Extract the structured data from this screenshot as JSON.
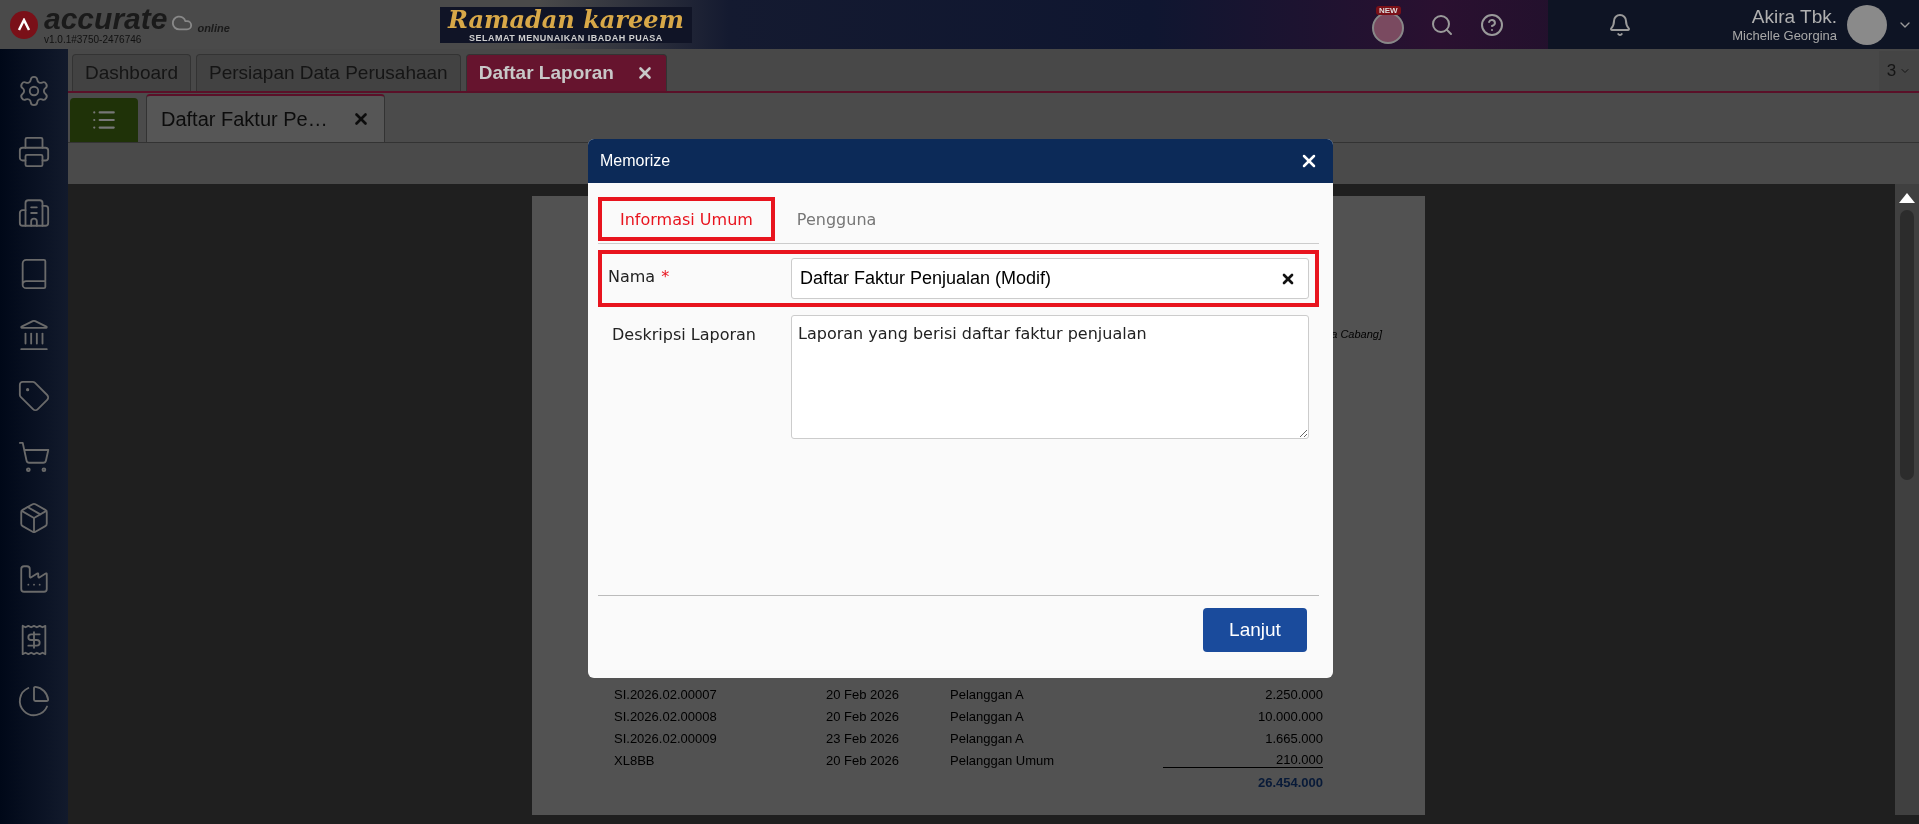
{
  "app": {
    "logo": "accurate",
    "logo_sub": "online",
    "version": "v1.0.1#3750-2476746"
  },
  "banner": {
    "title": "Ramadan kareem",
    "subtitle": "SELAMAT MENUNAIKAN IBADAH PUASA"
  },
  "header": {
    "badge": "NEW",
    "user_name": "Akira Tbk.",
    "user_sub": "Michelle Georgina"
  },
  "tabs": [
    {
      "label": "Dashboard",
      "selected": false,
      "closable": false
    },
    {
      "label": "Persiapan Data Perusahaan",
      "selected": false,
      "closable": false
    },
    {
      "label": "Daftar Laporan",
      "selected": true,
      "closable": true
    }
  ],
  "tab_count": "3",
  "subtab": {
    "label": "Daftar Faktur Pe…"
  },
  "report": {
    "note": "a Cabang]",
    "rows": [
      {
        "number": "SI.2026.02.00007",
        "date": "20 Feb 2026",
        "customer": "Pelanggan A",
        "amount": "2.250.000"
      },
      {
        "number": "SI.2026.02.00008",
        "date": "20 Feb 2026",
        "customer": "Pelanggan A",
        "amount": "10.000.000"
      },
      {
        "number": "SI.2026.02.00009",
        "date": "23 Feb 2026",
        "customer": "Pelanggan A",
        "amount": "1.665.000"
      },
      {
        "number": "XL8BB",
        "date": "20 Feb 2026",
        "customer": "Pelanggan Umum",
        "amount": "210.000"
      }
    ],
    "total": "26.454.000"
  },
  "dialog": {
    "title": "Memorize",
    "tabs": [
      {
        "label": "Informasi Umum",
        "selected": true,
        "highlighted": true
      },
      {
        "label": "Pengguna",
        "selected": false,
        "highlighted": false
      }
    ],
    "fields": [
      {
        "kind": "input",
        "label": "Nama",
        "required_mark": "*",
        "value": "Daftar Faktur Penjualan (Modif)",
        "highlighted": true
      },
      {
        "kind": "textarea",
        "label": "Deskripsi Laporan",
        "value": "Laporan yang berisi daftar faktur penjualan",
        "highlighted": false
      }
    ],
    "button": "Lanjut"
  }
}
